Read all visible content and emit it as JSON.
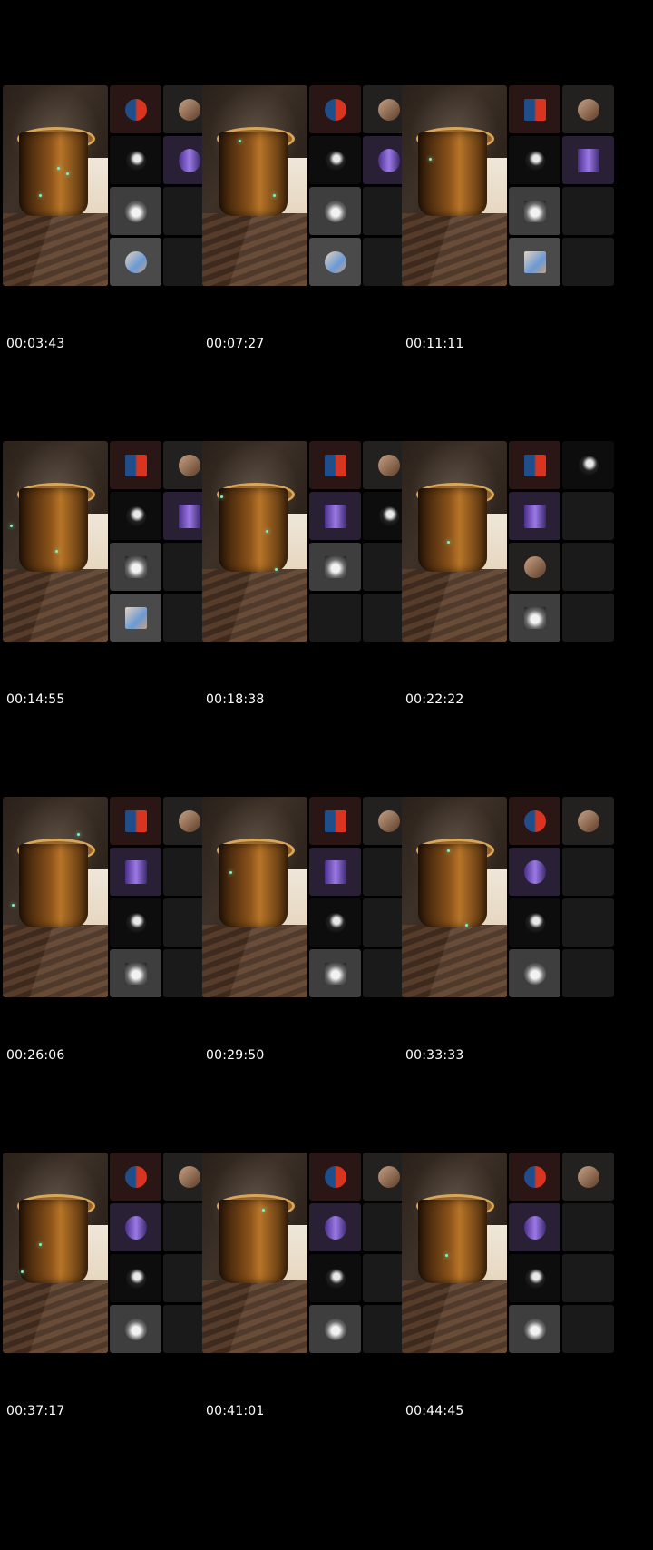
{
  "frames": [
    {
      "timecode": "00:03:43"
    },
    {
      "timecode": "00:07:27"
    },
    {
      "timecode": "00:11:11"
    },
    {
      "timecode": "00:14:55"
    },
    {
      "timecode": "00:18:38"
    },
    {
      "timecode": "00:22:22"
    },
    {
      "timecode": "00:26:06"
    },
    {
      "timecode": "00:29:50"
    },
    {
      "timecode": "00:33:33"
    },
    {
      "timecode": "00:37:17"
    },
    {
      "timecode": "00:41:01"
    },
    {
      "timecode": "00:44:45"
    }
  ]
}
